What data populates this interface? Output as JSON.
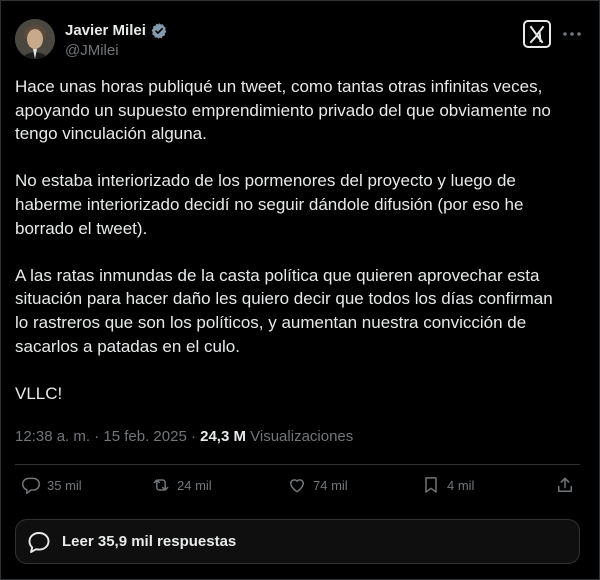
{
  "author": {
    "name": "Javier Milei",
    "handle": "@JMilei",
    "verified": true
  },
  "tweet": {
    "paragraphs": [
      "Hace unas horas publiqué un tweet, como tantas otras infinitas veces,\napoyando un supuesto emprendimiento privado del que obviamente no\ntengo vinculación alguna.",
      "No estaba interiorizado de los pormenores del proyecto y luego de\nhaberme interiorizado decidí no seguir dándole difusión (por eso he\nborrado el tweet).",
      "A las ratas inmundas de la casta política que quieren aprovechar esta\nsituación para hacer daño les quiero decir que todos los días confirman\nlo rastreros que son los políticos, y aumentan nuestra convicción de\nsacarlos a patadas en el culo.",
      "VLLC!"
    ]
  },
  "meta": {
    "time_date": "12:38 a. m. · 15 feb. 2025 · ",
    "views_count": "24,3 M",
    "views_label": " Visualizaciones"
  },
  "actions": {
    "replies": "35 mil",
    "reposts": "24 mil",
    "likes": "74 mil",
    "bookmarks": "4 mil"
  },
  "read_replies_label": "Leer 35,9 mil respuestas",
  "colors": {
    "background": "#000000",
    "text": "#e7e9ea",
    "muted": "#71767b",
    "border": "#2f3336",
    "verified": "#829aab"
  },
  "icons": [
    "verified-badge-icon",
    "x-logo-icon",
    "more-icon",
    "reply-icon",
    "repost-icon",
    "like-icon",
    "bookmark-icon",
    "share-icon",
    "speech-bubble-icon"
  ]
}
